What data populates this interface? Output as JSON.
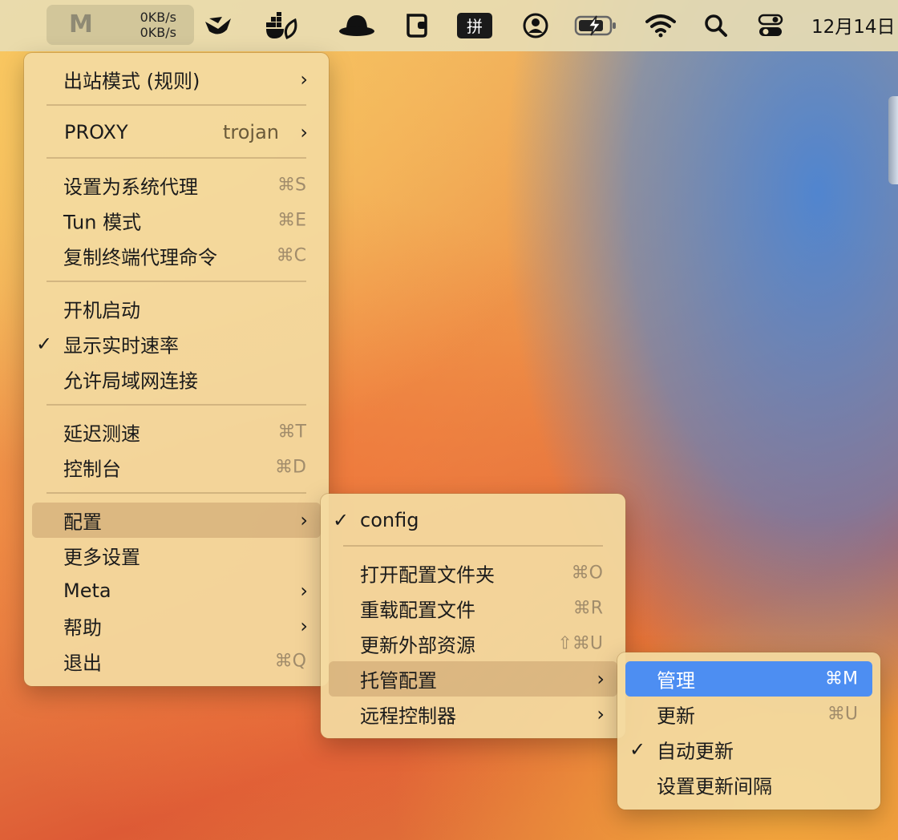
{
  "menubar": {
    "clash_logo": "M",
    "upload_speed": "0KB/s",
    "download_speed": "0KB/s",
    "clock": "12月14日",
    "ime_label": "拼",
    "icons": [
      "cloudcone-icon",
      "docker-icon",
      "hat-icon",
      "wallet-icon",
      "ime-icon",
      "user-icon",
      "battery-icon",
      "wifi-icon",
      "search-icon",
      "control-center-icon"
    ]
  },
  "main_menu": {
    "outbound_mode": "出站模式 (规则)",
    "proxy_label": "PROXY",
    "proxy_value": "trojan",
    "set_system_proxy": "设置为系统代理",
    "set_system_proxy_sc": "⌘S",
    "tun_mode": "Tun 模式",
    "tun_mode_sc": "⌘E",
    "copy_shell_cmd": "复制终端代理命令",
    "copy_shell_cmd_sc": "⌘C",
    "start_at_login": "开机启动",
    "show_speed": "显示实时速率",
    "allow_lan": "允许局域网连接",
    "latency_test": "延迟测速",
    "latency_test_sc": "⌘T",
    "dashboard": "控制台",
    "dashboard_sc": "⌘D",
    "config": "配置",
    "more_settings": "更多设置",
    "meta": "Meta",
    "help": "帮助",
    "quit": "退出",
    "quit_sc": "⌘Q",
    "check": "✓",
    "arrow": "›"
  },
  "config_menu": {
    "config_name": "config",
    "open_folder": "打开配置文件夹",
    "open_folder_sc": "⌘O",
    "reload": "重载配置文件",
    "reload_sc": "⌘R",
    "update_external": "更新外部资源",
    "update_external_sc": "⇧⌘U",
    "managed_config": "托管配置",
    "remote_controller": "远程控制器"
  },
  "managed_menu": {
    "manage": "管理",
    "manage_sc": "⌘M",
    "update": "更新",
    "update_sc": "⌘U",
    "auto_update": "自动更新",
    "set_interval": "设置更新间隔"
  },
  "colors": {
    "highlight": "#4d8ef2",
    "menu_bg": "#f3daa0",
    "selected_bg": "#c8a06e"
  }
}
